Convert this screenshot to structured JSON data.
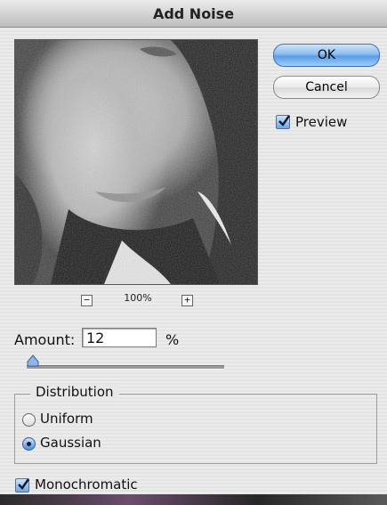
{
  "dialog": {
    "title": "Add Noise"
  },
  "preview_pane": {
    "zoom_minus": "−",
    "zoom_level": "100%",
    "zoom_plus": "+"
  },
  "buttons": {
    "ok": "OK",
    "cancel": "Cancel"
  },
  "preview_checkbox": {
    "label": "Preview",
    "checked": true
  },
  "amount": {
    "label": "Amount:",
    "value": "12",
    "unit": "%",
    "slider_fraction": 0.03
  },
  "distribution": {
    "title": "Distribution",
    "options": [
      "Uniform",
      "Gaussian"
    ],
    "selected": "Gaussian"
  },
  "monochromatic": {
    "label": "Monochromatic",
    "checked": true
  },
  "colors": {
    "ok_button": "#5b9be6",
    "accent": "#4b8ce0"
  }
}
